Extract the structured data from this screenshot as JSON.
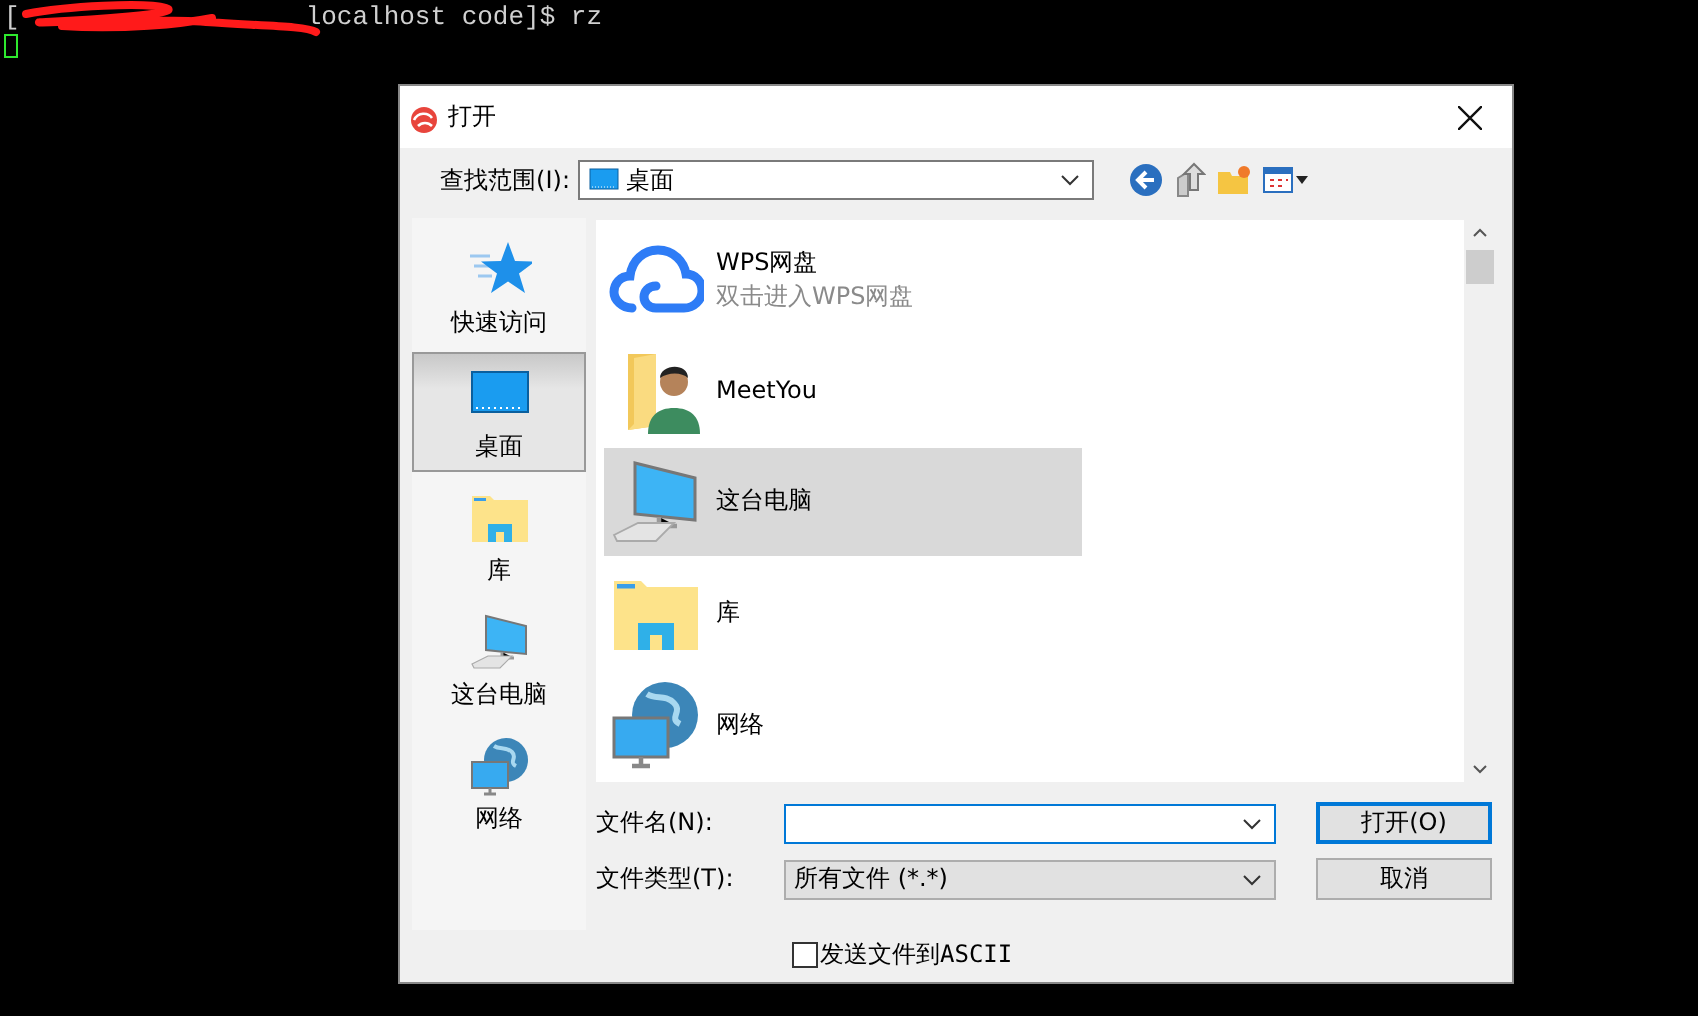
{
  "terminal": {
    "prompt_open": "[",
    "prompt_rest": "localhost code]$ rz",
    "redacted": true,
    "cursor": true
  },
  "dialog": {
    "title": "打开",
    "look_in": {
      "label": "查找范围(I):",
      "value": "桌面"
    },
    "places": [
      {
        "label": "快速访问",
        "kind": "star",
        "selected": false
      },
      {
        "label": "桌面",
        "kind": "desktop",
        "selected": true
      },
      {
        "label": "库",
        "kind": "library",
        "selected": false
      },
      {
        "label": "这台电脑",
        "kind": "computer",
        "selected": false
      },
      {
        "label": "网络",
        "kind": "network",
        "selected": false
      }
    ],
    "files": [
      {
        "name": "WPS网盘",
        "subtitle": "双击进入WPS网盘",
        "kind": "cloud",
        "selected": false
      },
      {
        "name": "MeetYou",
        "kind": "userfolder",
        "selected": false
      },
      {
        "name": "这台电脑",
        "kind": "computer",
        "selected": true
      },
      {
        "name": "库",
        "kind": "library",
        "selected": false
      },
      {
        "name": "网络",
        "kind": "network",
        "selected": false
      }
    ],
    "file_name": {
      "label": "文件名(N):"
    },
    "file_type": {
      "label": "文件类型(T):",
      "value": "所有文件 (*.*)"
    },
    "buttons": [
      {
        "label": "打开(O)",
        "kind": "default"
      },
      {
        "label": "取消",
        "kind": "normal"
      }
    ],
    "checkbox": {
      "label": "发送文件到ASCII",
      "checked": false
    }
  }
}
